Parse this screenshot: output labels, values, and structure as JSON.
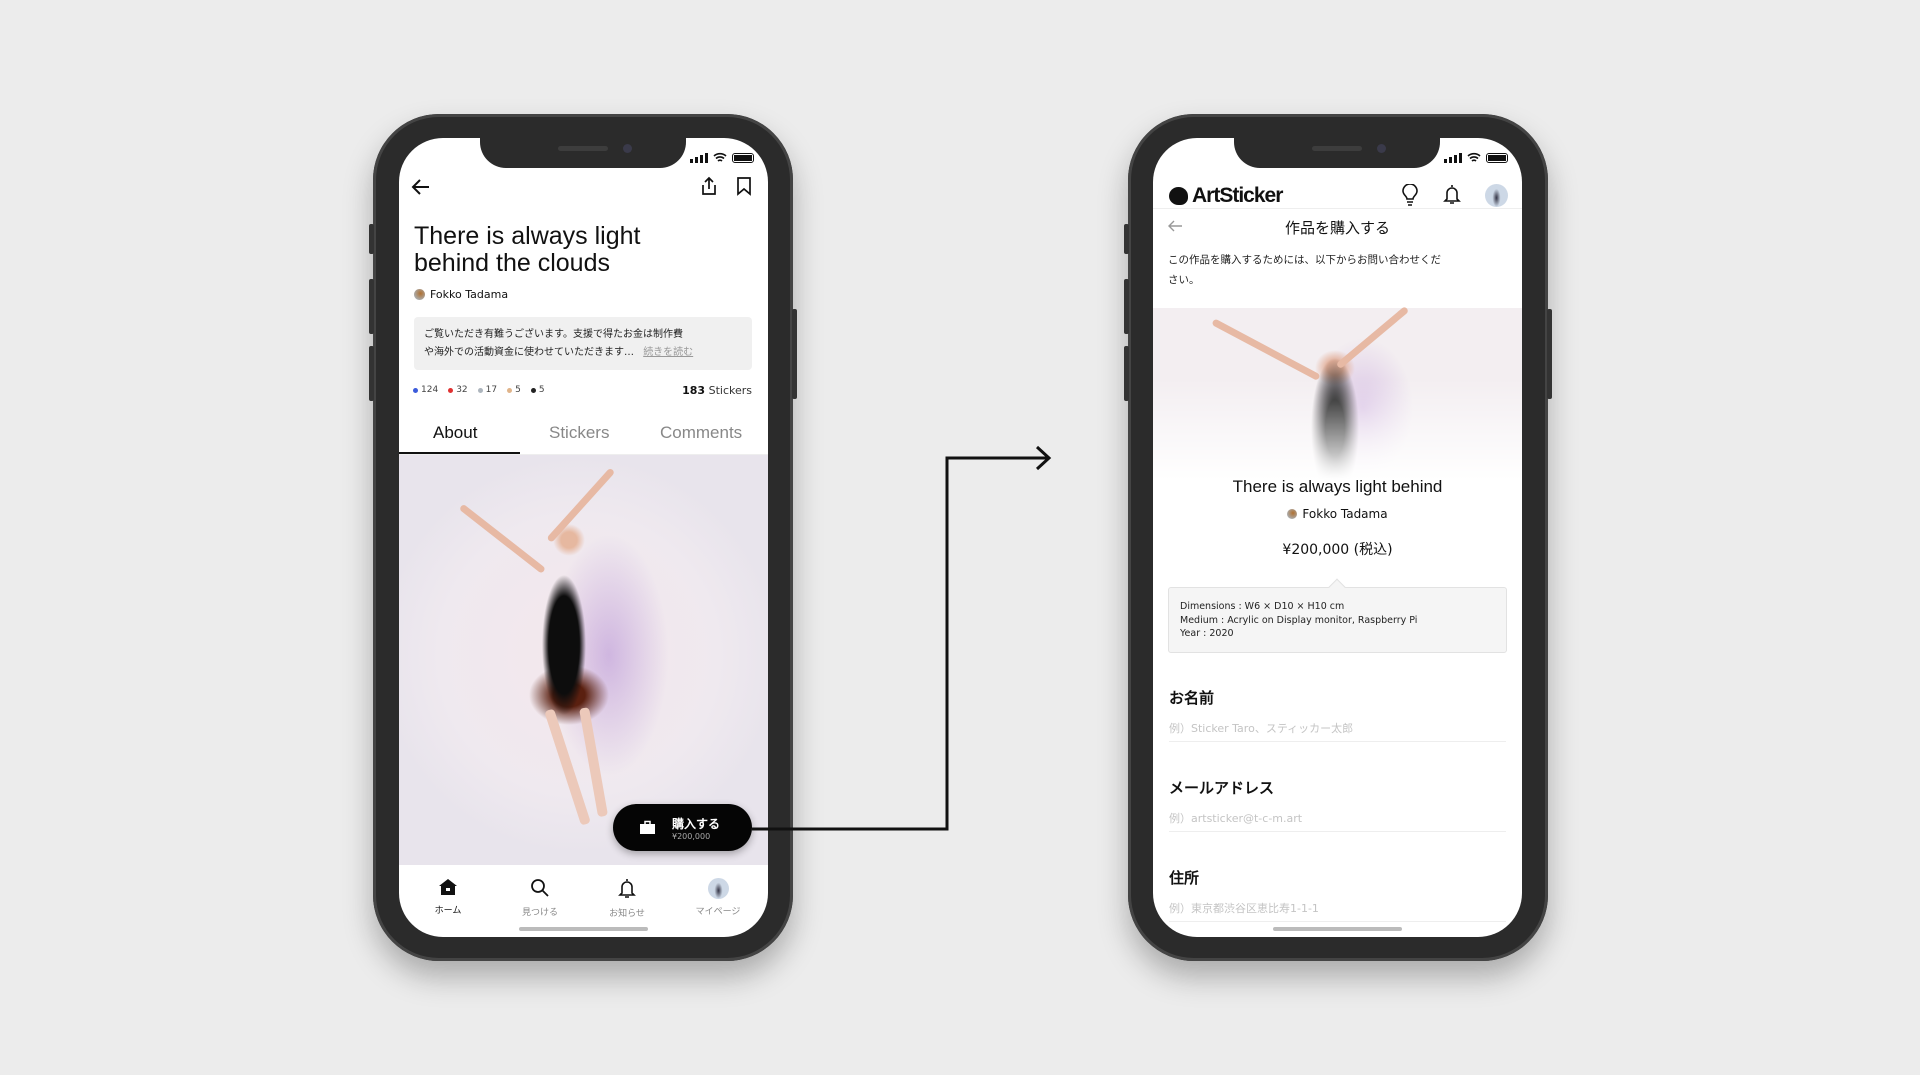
{
  "left_screen": {
    "title": "There is always light behind the clouds",
    "title_line1": "There is always light",
    "title_line2": "behind the clouds",
    "artist": "Fokko Tadama",
    "description_line1": "ご覧いただき有難うございます。支援で得たお金は制作費",
    "description_line2": "や海外での活動資金に使わせていただきます…",
    "read_more": "続きを読む",
    "sticker_counts": [
      {
        "color": "#3b5bdb",
        "count": "124"
      },
      {
        "color": "#e03131",
        "count": "32"
      },
      {
        "color": "#adb5bd",
        "count": "17"
      },
      {
        "color": "#e0b48a",
        "count": "5"
      },
      {
        "color": "#222222",
        "count": "5"
      }
    ],
    "sticker_total": "183",
    "sticker_total_label": "Stickers",
    "tabs": [
      {
        "label": "About",
        "active": true
      },
      {
        "label": "Stickers"
      },
      {
        "label": "Comments"
      }
    ],
    "buy_button": {
      "label": "購入する",
      "price": "¥200,000"
    },
    "bottom_nav": [
      {
        "label": "ホーム",
        "icon": "home-icon",
        "active": true
      },
      {
        "label": "見つける",
        "icon": "search-icon"
      },
      {
        "label": "お知らせ",
        "icon": "bell-icon"
      },
      {
        "label": "マイページ",
        "icon": "avatar-icon"
      }
    ]
  },
  "right_screen": {
    "logo": "ArtSticker",
    "page_title": "作品を購入する",
    "intro_line1": "この作品を購入するためには、以下からお問い合わせくだ",
    "intro_line2": "さい。",
    "artwork_title": "There is always light behind",
    "artist": "Fokko Tadama",
    "price": "¥200,000 (税込)",
    "specs": [
      "Dimensions : W6 × D10 × H10 cm",
      "Medium : Acrylic on Display monitor, Raspberry Pi",
      "Year : 2020"
    ],
    "form": [
      {
        "label": "お名前",
        "placeholder": "例）Sticker Taro、スティッカー太郎"
      },
      {
        "label": "メールアドレス",
        "placeholder": "例）artsticker@t-c-m.art"
      },
      {
        "label": "住所",
        "placeholder": "例）東京都渋谷区恵比寿1-1-1"
      }
    ]
  }
}
